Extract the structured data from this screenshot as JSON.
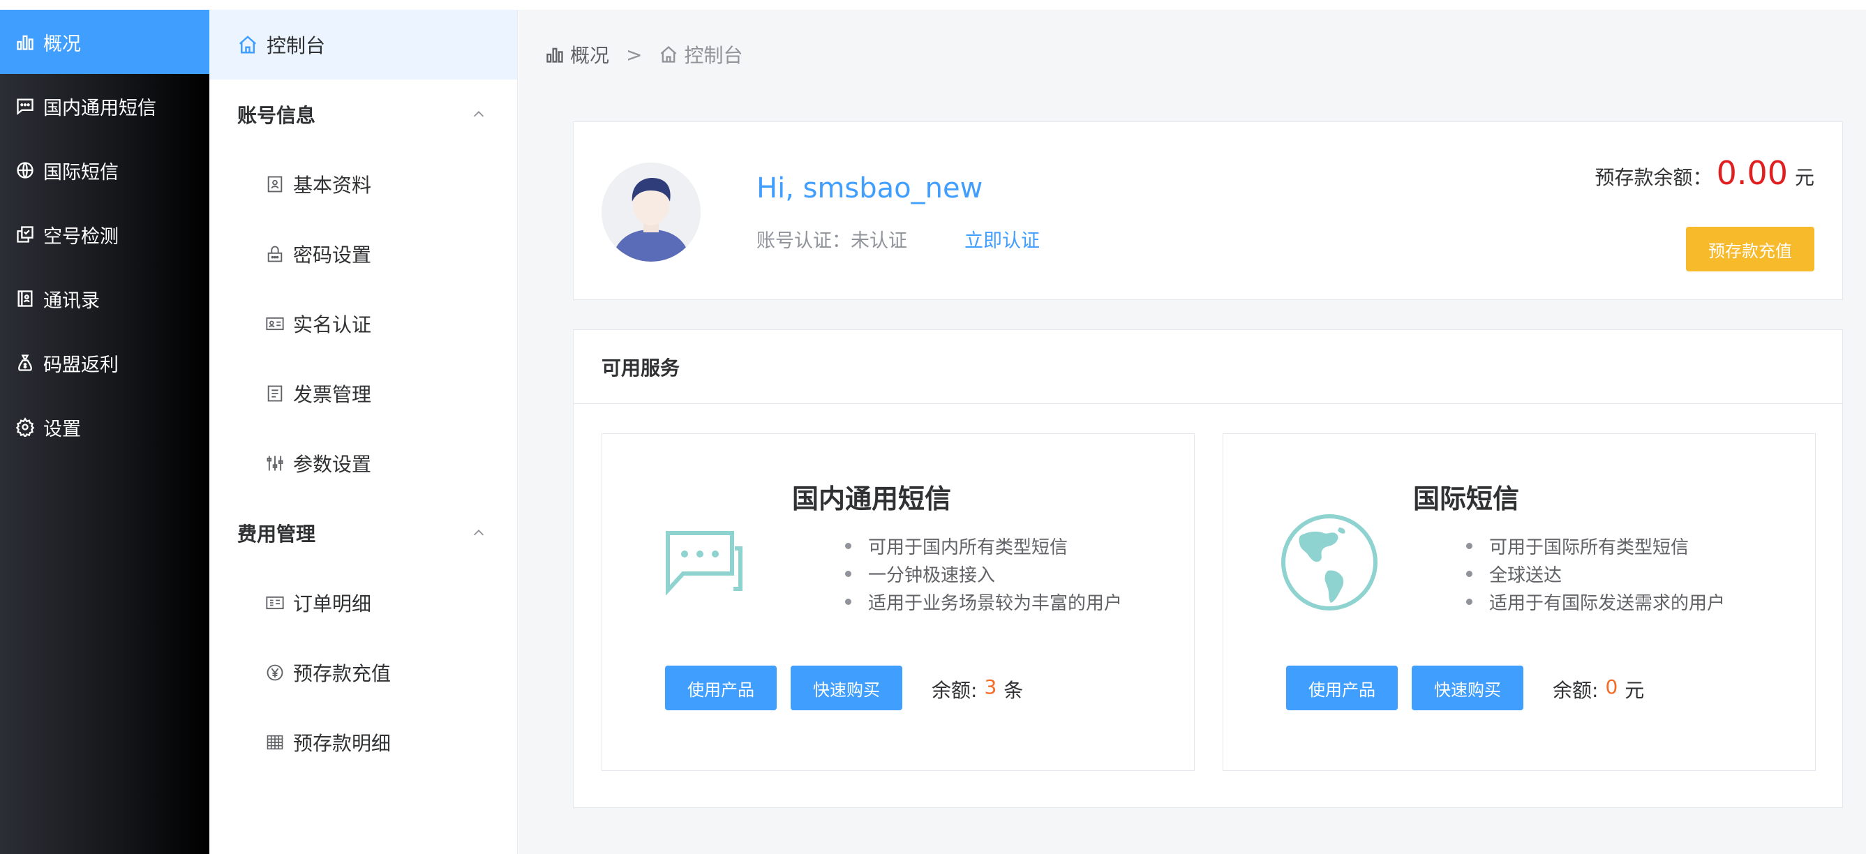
{
  "sidebar": {
    "items": [
      {
        "label": "概况",
        "icon": "bar-chart-icon",
        "active": true
      },
      {
        "label": "国内通用短信",
        "icon": "chat-icon"
      },
      {
        "label": "国际短信",
        "icon": "globe-icon"
      },
      {
        "label": "空号检测",
        "icon": "check-copy-icon"
      },
      {
        "label": "通讯录",
        "icon": "contacts-icon"
      },
      {
        "label": "码盟返利",
        "icon": "money-bag-icon"
      },
      {
        "label": "设置",
        "icon": "gear-icon"
      }
    ]
  },
  "submenu": {
    "top": {
      "label": "控制台",
      "icon": "home-icon"
    },
    "groups": [
      {
        "label": "账号信息",
        "items": [
          {
            "label": "基本资料",
            "icon": "profile-icon"
          },
          {
            "label": "密码设置",
            "icon": "lock-icon"
          },
          {
            "label": "实名认证",
            "icon": "id-card-icon"
          },
          {
            "label": "发票管理",
            "icon": "invoice-icon"
          },
          {
            "label": "参数设置",
            "icon": "sliders-icon"
          }
        ]
      },
      {
        "label": "费用管理",
        "items": [
          {
            "label": "订单明细",
            "icon": "order-icon"
          },
          {
            "label": "预存款充值",
            "icon": "yen-icon"
          },
          {
            "label": "预存款明细",
            "icon": "grid-icon"
          }
        ]
      }
    ]
  },
  "breadcrumb": {
    "first": "概况",
    "separator": ">",
    "last": "控制台"
  },
  "account": {
    "greeting": "Hi, smsbao_new",
    "auth_status": "账号认证：未认证",
    "auth_link": "立即认证",
    "balance_label": "预存款余额：",
    "balance_value": "0.00",
    "balance_unit": "元",
    "recharge_button": "预存款充值"
  },
  "services": {
    "header": "可用服务",
    "cards": [
      {
        "title": "国内通用短信",
        "features": [
          "可用于国内所有类型短信",
          "一分钟极速接入",
          "适用于业务场景较为丰富的用户"
        ],
        "use_button": "使用产品",
        "buy_button": "快速购买",
        "balance_label": "余额:",
        "balance_value": "3",
        "balance_unit": "条"
      },
      {
        "title": "国际短信",
        "features": [
          "可用于国际所有类型短信",
          "全球送达",
          "适用于有国际发送需求的用户"
        ],
        "use_button": "使用产品",
        "buy_button": "快速购买",
        "balance_label": "余额:",
        "balance_value": "0",
        "balance_unit": "元"
      }
    ]
  },
  "colors": {
    "primary": "#409eff",
    "warning": "#f7ba2a",
    "danger": "#e02020",
    "accent_teal": "#8fd3d0"
  }
}
